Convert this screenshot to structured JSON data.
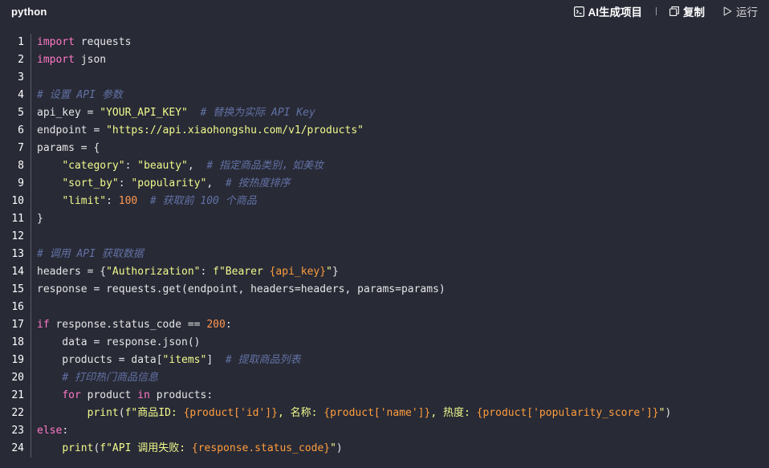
{
  "header": {
    "language": "python",
    "ai_label": "AI生成项目",
    "copy_label": "复制",
    "run_label": "运行"
  },
  "code": {
    "line_numbers": [
      "1",
      "2",
      "3",
      "4",
      "5",
      "6",
      "7",
      "8",
      "9",
      "10",
      "11",
      "12",
      "13",
      "14",
      "15",
      "16",
      "17",
      "18",
      "19",
      "20",
      "21",
      "22",
      "23",
      "24"
    ],
    "lines": [
      [
        {
          "t": "import",
          "c": "kw"
        },
        {
          "t": " requests",
          "c": ""
        }
      ],
      [
        {
          "t": "import",
          "c": "kw"
        },
        {
          "t": " json",
          "c": ""
        }
      ],
      [],
      [
        {
          "t": "# 设置 API 参数",
          "c": "cm"
        }
      ],
      [
        {
          "t": "api_key = ",
          "c": ""
        },
        {
          "t": "\"YOUR_API_KEY\"",
          "c": "str"
        },
        {
          "t": "  ",
          "c": ""
        },
        {
          "t": "# 替换为实际 API Key",
          "c": "cm"
        }
      ],
      [
        {
          "t": "endpoint = ",
          "c": ""
        },
        {
          "t": "\"https://api.xiaohongshu.com/v1/products\"",
          "c": "str"
        }
      ],
      [
        {
          "t": "params = {",
          "c": ""
        }
      ],
      [
        {
          "t": "    ",
          "c": ""
        },
        {
          "t": "\"category\"",
          "c": "str"
        },
        {
          "t": ": ",
          "c": ""
        },
        {
          "t": "\"beauty\"",
          "c": "str"
        },
        {
          "t": ",  ",
          "c": ""
        },
        {
          "t": "# 指定商品类别，如美妆",
          "c": "cm"
        }
      ],
      [
        {
          "t": "    ",
          "c": ""
        },
        {
          "t": "\"sort_by\"",
          "c": "str"
        },
        {
          "t": ": ",
          "c": ""
        },
        {
          "t": "\"popularity\"",
          "c": "str"
        },
        {
          "t": ",  ",
          "c": ""
        },
        {
          "t": "# 按热度排序",
          "c": "cm"
        }
      ],
      [
        {
          "t": "    ",
          "c": ""
        },
        {
          "t": "\"limit\"",
          "c": "str"
        },
        {
          "t": ": ",
          "c": ""
        },
        {
          "t": "100",
          "c": "num"
        },
        {
          "t": "  ",
          "c": ""
        },
        {
          "t": "# 获取前 100 个商品",
          "c": "cm"
        }
      ],
      [
        {
          "t": "}",
          "c": ""
        }
      ],
      [],
      [
        {
          "t": "# 调用 API 获取数据",
          "c": "cm"
        }
      ],
      [
        {
          "t": "headers = {",
          "c": ""
        },
        {
          "t": "\"Authorization\"",
          "c": "str"
        },
        {
          "t": ": ",
          "c": ""
        },
        {
          "t": "f\"Bearer ",
          "c": "str"
        },
        {
          "t": "{api_key}",
          "c": "int"
        },
        {
          "t": "\"",
          "c": "str"
        },
        {
          "t": "}",
          "c": ""
        }
      ],
      [
        {
          "t": "response = requests.get(endpoint, headers=headers, params=params)",
          "c": ""
        }
      ],
      [],
      [
        {
          "t": "if",
          "c": "kw"
        },
        {
          "t": " response.status_code == ",
          "c": ""
        },
        {
          "t": "200",
          "c": "num"
        },
        {
          "t": ":",
          "c": ""
        }
      ],
      [
        {
          "t": "    data = response.json()",
          "c": ""
        }
      ],
      [
        {
          "t": "    products = data[",
          "c": ""
        },
        {
          "t": "\"items\"",
          "c": "str"
        },
        {
          "t": "]  ",
          "c": ""
        },
        {
          "t": "# 提取商品列表",
          "c": "cm"
        }
      ],
      [
        {
          "t": "    ",
          "c": ""
        },
        {
          "t": "# 打印热门商品信息",
          "c": "cm"
        }
      ],
      [
        {
          "t": "    ",
          "c": ""
        },
        {
          "t": "for",
          "c": "kw"
        },
        {
          "t": " product ",
          "c": ""
        },
        {
          "t": "in",
          "c": "kw"
        },
        {
          "t": " products:",
          "c": ""
        }
      ],
      [
        {
          "t": "        ",
          "c": ""
        },
        {
          "t": "print",
          "c": "fn"
        },
        {
          "t": "(",
          "c": ""
        },
        {
          "t": "f\"商品ID: ",
          "c": "str"
        },
        {
          "t": "{product['id']}",
          "c": "int"
        },
        {
          "t": ", 名称: ",
          "c": "str"
        },
        {
          "t": "{product['name']}",
          "c": "int"
        },
        {
          "t": ", 热度: ",
          "c": "str"
        },
        {
          "t": "{product['popularity_score']}",
          "c": "int"
        },
        {
          "t": "\"",
          "c": "str"
        },
        {
          "t": ")",
          "c": ""
        }
      ],
      [
        {
          "t": "else",
          "c": "kw"
        },
        {
          "t": ":",
          "c": ""
        }
      ],
      [
        {
          "t": "    ",
          "c": ""
        },
        {
          "t": "print",
          "c": "fn"
        },
        {
          "t": "(",
          "c": ""
        },
        {
          "t": "f\"API 调用失败: ",
          "c": "str"
        },
        {
          "t": "{response.status_code}",
          "c": "int"
        },
        {
          "t": "\"",
          "c": "str"
        },
        {
          "t": ")",
          "c": ""
        }
      ]
    ]
  }
}
